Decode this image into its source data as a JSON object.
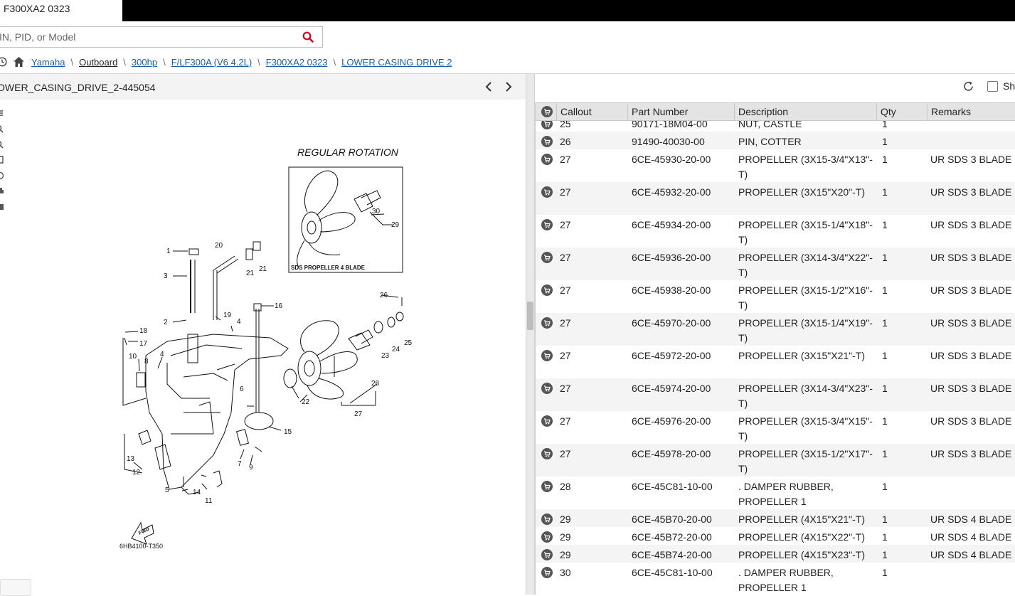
{
  "tab": {
    "title": "F300XA2 0323"
  },
  "search": {
    "placeholder": "IN, PID, or Model"
  },
  "breadcrumb": {
    "items": [
      "Yamaha",
      "Outboard",
      "300hp",
      "F/LF300A (V6 4.2L)",
      "F300XA2 0323",
      "LOWER CASING DRIVE 2"
    ],
    "separator": "\\"
  },
  "diagram": {
    "title": "OWER_CASING_DRIVE_2-445054",
    "rotation_label": "REGULAR ROTATION",
    "inset_label": "SDS PROPELLER 4 BLADE",
    "code": "6HB4100-T350",
    "fwd": "FWD",
    "callouts": [
      "1",
      "2",
      "3",
      "4",
      "4",
      "5",
      "6",
      "7",
      "8",
      "9",
      "10",
      "11",
      "12",
      "13",
      "14",
      "15",
      "16",
      "17",
      "18",
      "19",
      "20",
      "21",
      "21",
      "22",
      "23",
      "24",
      "25",
      "26",
      "27",
      "28",
      "29",
      "30"
    ]
  },
  "right": {
    "show_label": "Sh"
  },
  "table": {
    "headers": [
      "Callout",
      "Part Number",
      "Description",
      "Qty",
      "Remarks"
    ],
    "rows": [
      {
        "callout": "25",
        "part": "90171-18M04-00",
        "desc": "NUT, CASTLE",
        "qty": "1",
        "remarks": ""
      },
      {
        "callout": "26",
        "part": "91490-40030-00",
        "desc": "PIN, COTTER",
        "qty": "1",
        "remarks": ""
      },
      {
        "callout": "27",
        "part": "6CE-45930-20-00",
        "desc": "PROPELLER (3X15-3/4\"X13\"-T)",
        "qty": "1",
        "remarks": "UR SDS 3 BLADE"
      },
      {
        "callout": "27",
        "part": "6CE-45932-20-00",
        "desc": "PROPELLER (3X15\"X20\"-T)",
        "qty": "1",
        "remarks": "UR SDS 3 BLADE"
      },
      {
        "callout": "27",
        "part": "6CE-45934-20-00",
        "desc": "PROPELLER (3X15-1/4\"X18\"-T)",
        "qty": "1",
        "remarks": "UR SDS 3 BLADE"
      },
      {
        "callout": "27",
        "part": "6CE-45936-20-00",
        "desc": "PROPELLER (3X14-3/4\"X22\"-T)",
        "qty": "1",
        "remarks": "UR SDS 3 BLADE"
      },
      {
        "callout": "27",
        "part": "6CE-45938-20-00",
        "desc": "PROPELLER (3X15-1/2\"X16\"-T)",
        "qty": "1",
        "remarks": "UR SDS 3 BLADE"
      },
      {
        "callout": "27",
        "part": "6CE-45970-20-00",
        "desc": "PROPELLER (3X15-1/4\"X19\"-T)",
        "qty": "1",
        "remarks": "UR SDS 3 BLADE"
      },
      {
        "callout": "27",
        "part": "6CE-45972-20-00",
        "desc": "PROPELLER (3X15\"X21\"-T)",
        "qty": "1",
        "remarks": "UR SDS 3 BLADE"
      },
      {
        "callout": "27",
        "part": "6CE-45974-20-00",
        "desc": "PROPELLER (3X14-3/4\"X23\"-T)",
        "qty": "1",
        "remarks": "UR SDS 3 BLADE"
      },
      {
        "callout": "27",
        "part": "6CE-45976-20-00",
        "desc": "PROPELLER (3X15-3/4\"X15\"-T)",
        "qty": "1",
        "remarks": "UR SDS 3 BLADE"
      },
      {
        "callout": "27",
        "part": "6CE-45978-20-00",
        "desc": "PROPELLER (3X15-1/2\"X17\"-T)",
        "qty": "1",
        "remarks": "UR SDS 3 BLADE"
      },
      {
        "callout": "28",
        "part": "6CE-45C81-10-00",
        "desc": ". DAMPER RUBBER, PROPELLER 1",
        "qty": "1",
        "remarks": ""
      },
      {
        "callout": "29",
        "part": "6CE-45B70-20-00",
        "desc": "PROPELLER (4X15\"X21\"-T)",
        "qty": "1",
        "remarks": "UR SDS 4 BLADE"
      },
      {
        "callout": "29",
        "part": "6CE-45B72-20-00",
        "desc": "PROPELLER (4X15\"X22\"-T)",
        "qty": "1",
        "remarks": "UR SDS 4 BLADE"
      },
      {
        "callout": "29",
        "part": "6CE-45B74-20-00",
        "desc": "PROPELLER (4X15\"X23\"-T)",
        "qty": "1",
        "remarks": "UR SDS 4 BLADE"
      },
      {
        "callout": "30",
        "part": "6CE-45C81-10-00",
        "desc": ". DAMPER RUBBER, PROPELLER 1",
        "qty": "1",
        "remarks": ""
      }
    ]
  },
  "colors": {
    "link": "#1a5ea8",
    "accent": "#d0021b",
    "header_bg": "#e4e4e4",
    "row_alt": "#f4f4f4"
  },
  "icons": [
    "history-icon",
    "home-icon",
    "search-icon",
    "chevron-left-icon",
    "chevron-right-icon",
    "refresh-icon",
    "cart-icon"
  ]
}
